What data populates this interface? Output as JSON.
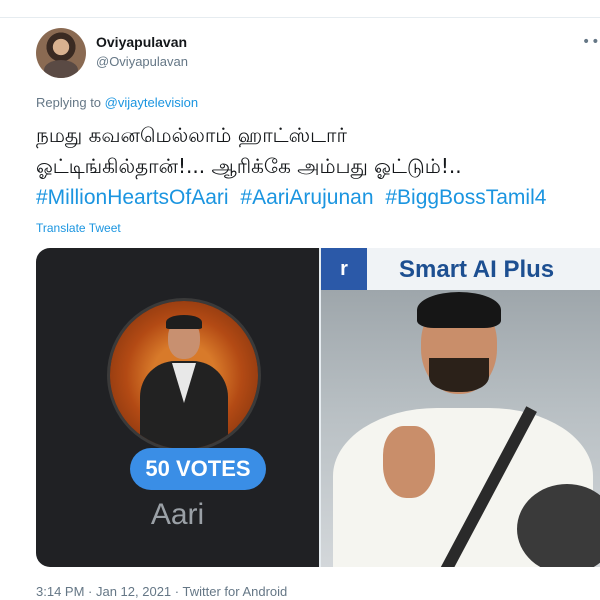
{
  "tweet": {
    "display_name": "Oviyapulavan",
    "handle": "@Oviyapulavan",
    "more_icon": "more-dots-icon",
    "replying_prefix": "Replying to ",
    "replying_to": "@vijaytelevision",
    "text_line1": "நமது கவனமெல்லாம் ஹாட்ஸ்டார்",
    "text_line2": "ஓட்டிங்கில்தான்!... ஆரிக்கே அம்பது ஓட்டும்!..",
    "hashtags": [
      "#MillionHeartsOfAari",
      "#AariArujunan",
      "#BiggBossTamil4"
    ],
    "translate": "Translate Tweet",
    "time": "3:14 PM",
    "date": "Jan 12, 2021",
    "source": "Twitter for Android"
  },
  "media": {
    "image1": {
      "votes_label": "50 VOTES",
      "name": "Aari"
    },
    "image2": {
      "banner_left": "r",
      "banner_text": "Smart AI Plus"
    }
  },
  "colors": {
    "link": "#1b95e0",
    "secondary": "#657786",
    "votes_pill": "#3a8ee6"
  }
}
